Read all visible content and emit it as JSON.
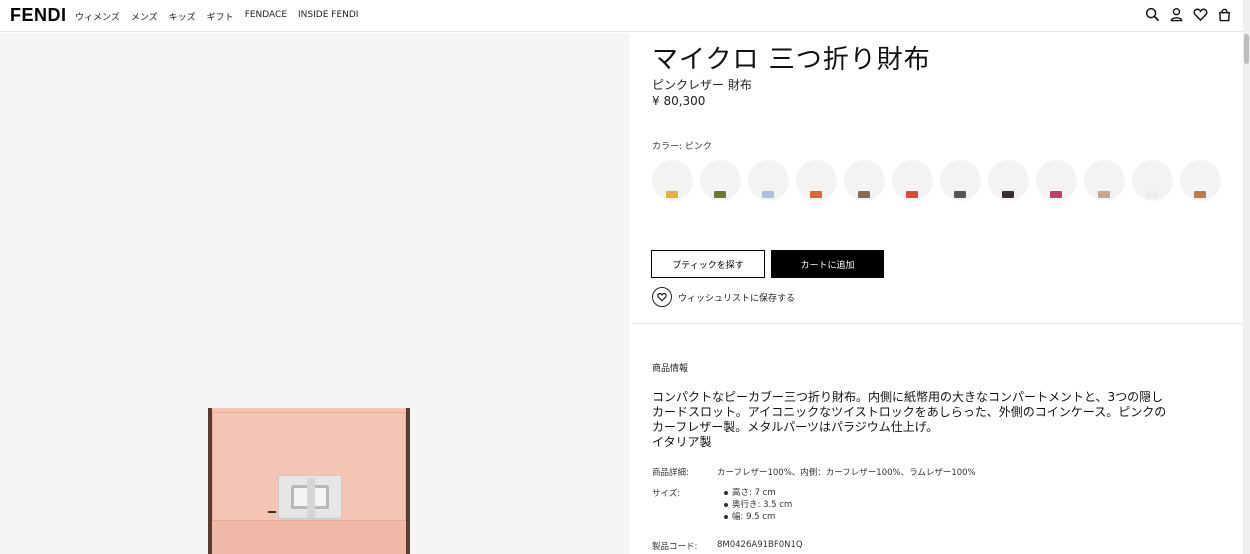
{
  "brand": "FENDI",
  "nav": [
    "ウィメンズ",
    "メンズ",
    "キッズ",
    "ギフト",
    "FENDACE",
    "INSIDE FENDI"
  ],
  "header_icons": [
    "search-icon",
    "user-icon",
    "heart-icon",
    "bag-icon"
  ],
  "product": {
    "title": "マイクロ 三つ折り財布",
    "subtitle": "ピンクレザー 財布",
    "price": "¥ 80,300",
    "color_label": "カラー:  ピンク",
    "swatches": [
      "#e8b23a",
      "#6a7d2a",
      "#a9c3e0",
      "#e0652f",
      "#8a6a4e",
      "#e04a2c",
      "#555555",
      "#3a302c",
      "#c73a6e",
      "#c8a98c",
      "#ececec",
      "#c07a46"
    ],
    "find_boutique": "ブティックを探す",
    "add_to_cart": "カートに追加",
    "wishlist": "ウィッシュリストに保存する"
  },
  "details": {
    "section_title": "商品情報",
    "description": "コンパクトなピーカブー三つ折り財布。内側に紙幣用の大きなコンパートメントと、3つの隠しカードスロット。アイコニックなツイストロックをあしらった、外側のコインケース。ピンクのカーフレザー製。メタルパーツはパラジウム仕上げ。",
    "origin": "イタリア製",
    "material_label": "商品詳細:",
    "material_value": "カーフレザー100%、内側：カーフレザー100%、ラムレザー100%",
    "size_label": "サイズ:",
    "sizes": [
      "高さ: 7 cm",
      "奥行き: 3.5 cm",
      "幅: 9.5 cm"
    ],
    "code_label": "製品コード:",
    "code_value": "8M0426A91BF0N1Q"
  }
}
